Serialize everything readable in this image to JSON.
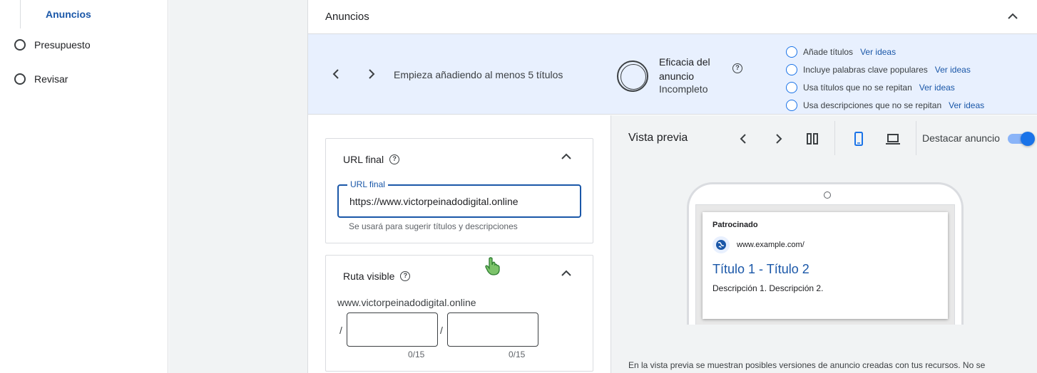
{
  "sidebar": {
    "sub_item": "Anuncios",
    "items": [
      {
        "label": "Presupuesto"
      },
      {
        "label": "Revisar"
      }
    ]
  },
  "main": {
    "title": "Anuncios"
  },
  "banner": {
    "message": "Empieza añadiendo al menos 5 títulos",
    "effectiveness_title": "Eficacia del anuncio",
    "effectiveness_status": "Incompleto",
    "tips": [
      {
        "text": "Añade títulos",
        "link": "Ver ideas"
      },
      {
        "text": "Incluye palabras clave populares",
        "link": "Ver ideas"
      },
      {
        "text": "Usa títulos que no se repitan",
        "link": "Ver ideas"
      },
      {
        "text": "Usa descripciones que no se repitan",
        "link": "Ver ideas"
      }
    ]
  },
  "final_url": {
    "title": "URL final",
    "field_label": "URL final",
    "value": "https://www.victorpeinadodigital.online",
    "helper": "Se usará para sugerir títulos y descripciones"
  },
  "visible_path": {
    "title": "Ruta visible",
    "domain": "www.victorpeinadodigital.online",
    "separator": "/",
    "path1_counter": "0/15",
    "path2_counter": "0/15"
  },
  "preview": {
    "title": "Vista previa",
    "highlight_label": "Destacar anuncio",
    "ad": {
      "sponsored": "Patrocinado",
      "url": "www.example.com/",
      "headline": "Título 1 - Título 2",
      "description": "Descripción 1. Descripción 2."
    },
    "footer": "En la vista previa se muestran posibles versiones de anuncio creadas con tus recursos. No se"
  },
  "colors": {
    "accent": "#1a57a8",
    "banner_bg": "#e8f0fe",
    "gutter_bg": "#f1f3f4"
  }
}
